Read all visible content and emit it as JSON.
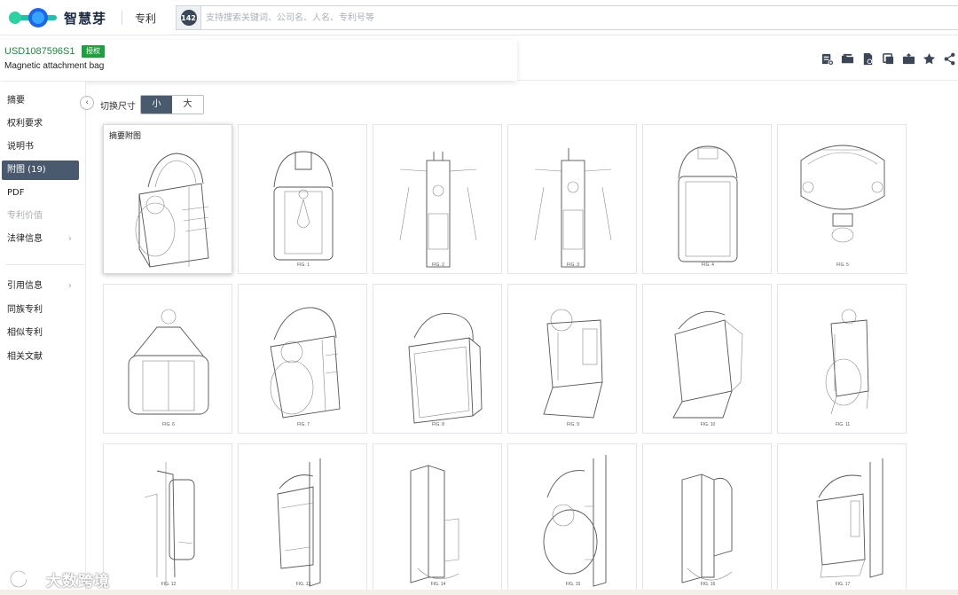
{
  "topbar": {
    "logo_text": "智慧芽",
    "section": "专利",
    "search_count": "142",
    "search_placeholder": "支持搜索关键词、公司名、人名、专利号等"
  },
  "patent": {
    "number": "USD1087596S1",
    "status": "授权",
    "title": "Magnetic attachment bag"
  },
  "tools": [
    {
      "icon": "add-note-icon"
    },
    {
      "icon": "folder-icon"
    },
    {
      "icon": "pdf-download-icon"
    },
    {
      "icon": "copy-icon"
    },
    {
      "icon": "image-export-icon"
    },
    {
      "icon": "star-icon"
    },
    {
      "icon": "share-icon"
    }
  ],
  "sidebar": {
    "items": [
      {
        "label": "摘要",
        "state": "normal"
      },
      {
        "label": "权利要求",
        "state": "normal"
      },
      {
        "label": "说明书",
        "state": "normal"
      },
      {
        "label": "附图 (19)",
        "state": "active"
      },
      {
        "label": "PDF",
        "state": "normal"
      },
      {
        "label": "专利价值",
        "state": "disabled"
      },
      {
        "label": "法律信息",
        "state": "normal",
        "chevron": "›"
      },
      {
        "label": "引用信息",
        "state": "normal",
        "chevron": "›"
      },
      {
        "label": "同族专利",
        "state": "normal"
      },
      {
        "label": "相似专利",
        "state": "normal"
      },
      {
        "label": "相关文献",
        "state": "normal"
      }
    ]
  },
  "gallery": {
    "size_label": "切换尺寸",
    "size_options": [
      "小",
      "大"
    ],
    "selected_size": "小",
    "featured_caption": "摘要附图",
    "figures": [
      {
        "caption": ""
      },
      {
        "caption": "FIG. 1"
      },
      {
        "caption": "FIG. 2"
      },
      {
        "caption": "FIG. 3"
      },
      {
        "caption": "FIG. 4"
      },
      {
        "caption": "FIG. 5"
      },
      {
        "caption": "FIG. 6"
      },
      {
        "caption": "FIG. 7"
      },
      {
        "caption": "FIG. 8"
      },
      {
        "caption": "FIG. 9"
      },
      {
        "caption": "FIG. 10"
      },
      {
        "caption": "FIG. 11"
      },
      {
        "caption": "FIG. 12"
      },
      {
        "caption": "FIG. 13"
      },
      {
        "caption": "FIG. 14"
      },
      {
        "caption": "FIG. 15"
      },
      {
        "caption": "FIG. 16"
      },
      {
        "caption": "FIG. 17"
      }
    ]
  },
  "watermark": {
    "text": "大数跨境"
  },
  "colors": {
    "accent": "#4a5a6e",
    "granted": "#1fa03f",
    "patent_number": "#1f8a3b",
    "logo_blue": "#1b66f0",
    "logo_green": "#21c2a6"
  }
}
